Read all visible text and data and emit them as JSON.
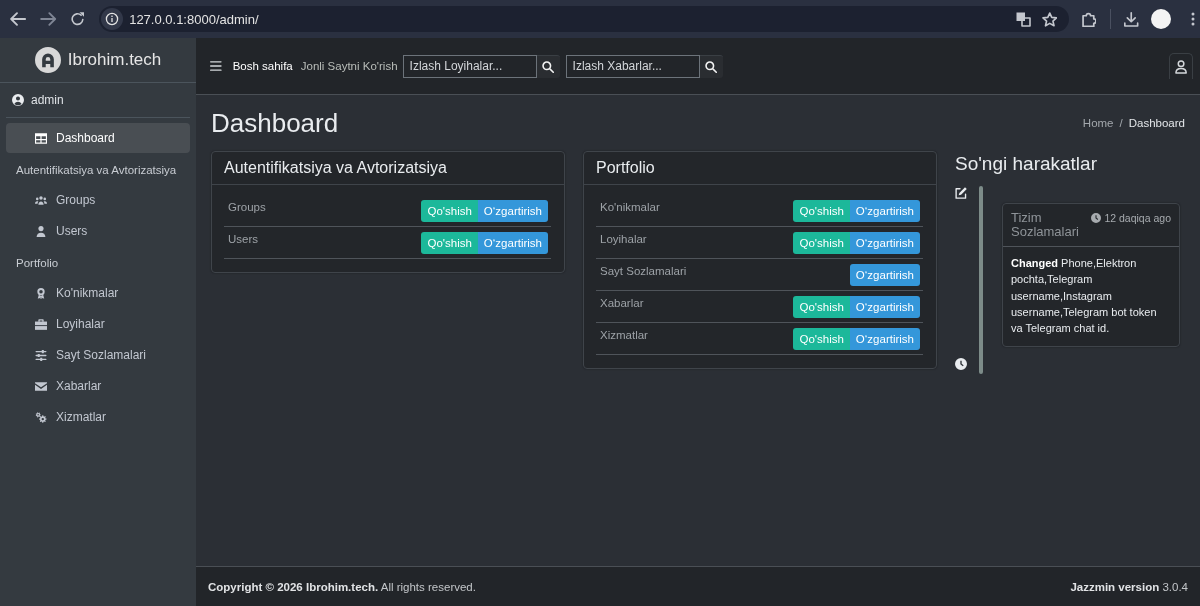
{
  "browser": {
    "url": "127.0.0.1:8000/admin/"
  },
  "sidebar": {
    "brand": "Ibrohim.tech",
    "user": "admin",
    "items": [
      {
        "kind": "link",
        "label": "Dashboard",
        "selected": true
      },
      {
        "kind": "header",
        "label": "Autentifikatsiya va Avtorizatsiya"
      },
      {
        "kind": "link",
        "label": "Groups",
        "selected": false
      },
      {
        "kind": "link",
        "label": "Users",
        "selected": false
      },
      {
        "kind": "header",
        "label": "Portfolio"
      },
      {
        "kind": "link",
        "label": "Ko'nikmalar",
        "selected": false
      },
      {
        "kind": "link",
        "label": "Loyihalar",
        "selected": false
      },
      {
        "kind": "link",
        "label": "Sayt Sozlamalari",
        "selected": false
      },
      {
        "kind": "link",
        "label": "Xabarlar",
        "selected": false
      },
      {
        "kind": "link",
        "label": "Xizmatlar",
        "selected": false
      }
    ]
  },
  "navbar": {
    "links": [
      {
        "label": "Bosh sahifa",
        "selected": true
      },
      {
        "label": "Jonli Saytni Ko'rish",
        "selected": false
      }
    ],
    "searches": [
      {
        "placeholder": "Izlash Loyihalar..."
      },
      {
        "placeholder": "Izlash Xabarlar..."
      }
    ]
  },
  "page": {
    "title": "Dashboard",
    "breadcrumb": [
      {
        "kind": "link",
        "label": "Home"
      },
      {
        "kind": "current",
        "label": "Dashboard"
      }
    ],
    "breadcrumb_separator": "/"
  },
  "apps": [
    {
      "title": "Autentifikatsiya va Avtorizatsiya",
      "models": [
        {
          "name": "Groups",
          "actions": [
            {
              "kind": "add",
              "label": "Qo'shish"
            },
            {
              "kind": "change",
              "label": "O‘zgartirish"
            }
          ]
        },
        {
          "name": "Users",
          "actions": [
            {
              "kind": "add",
              "label": "Qo'shish"
            },
            {
              "kind": "change",
              "label": "O‘zgartirish"
            }
          ]
        }
      ]
    },
    {
      "title": "Portfolio",
      "models": [
        {
          "name": "Ko'nikmalar",
          "actions": [
            {
              "kind": "add",
              "label": "Qo'shish"
            },
            {
              "kind": "change",
              "label": "O‘zgartirish"
            }
          ]
        },
        {
          "name": "Loyihalar",
          "actions": [
            {
              "kind": "add",
              "label": "Qo'shish"
            },
            {
              "kind": "change",
              "label": "O‘zgartirish"
            }
          ]
        },
        {
          "name": "Sayt Sozlamalari",
          "actions": [
            {
              "kind": "change",
              "label": "O‘zgartirish"
            }
          ]
        },
        {
          "name": "Xabarlar",
          "actions": [
            {
              "kind": "add",
              "label": "Qo'shish"
            },
            {
              "kind": "change",
              "label": "O‘zgartirish"
            }
          ]
        },
        {
          "name": "Xizmatlar",
          "actions": [
            {
              "kind": "add",
              "label": "Qo'shish"
            },
            {
              "kind": "change",
              "label": "O‘zgartirish"
            }
          ]
        }
      ]
    }
  ],
  "recent_actions": {
    "title": "So'ngi harakatlar",
    "entries": [
      {
        "kind": "change",
        "object": "Tizim Sozlamalari",
        "time": "12 daqiqa ago",
        "message": "**Changed** Phone,Elektron pochta,Telegram username,Instagram username,Telegram bot token va Telegram chat id."
      }
    ]
  },
  "footer": {
    "copyright": "**Copyright © 2026 Ibrohim.tech.** All rights reserved.",
    "version": "**Jazzmin version** 3.0.4"
  }
}
